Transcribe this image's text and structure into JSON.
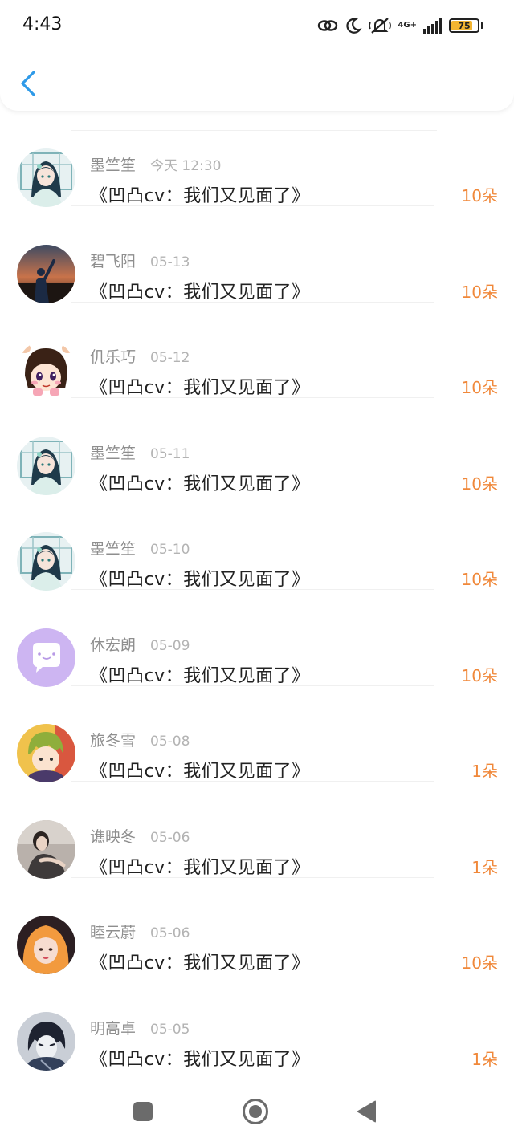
{
  "status_bar": {
    "time": "4:43",
    "network_label": "4G+",
    "battery_level": "75",
    "battery_fraction": 0.75,
    "icons": [
      "link-icon",
      "moon-icon",
      "mute-icon",
      "signal-icon",
      "battery-icon"
    ]
  },
  "header": {
    "back_icon": "chevron-left-icon",
    "accent_color": "#2f9ae8"
  },
  "colors": {
    "gift_count": "#f0883a",
    "sender_name": "#8e8e8e",
    "sender_time": "#b3b3b3",
    "message": "#222222"
  },
  "items": [
    {
      "name": "墨竺笙",
      "time": "今天 12:30",
      "message": "《凹凸cv：我们又见面了》",
      "gift": "10朵",
      "avatar": "anime-girl-avatar"
    },
    {
      "name": "碧飞阳",
      "time": "05-13",
      "message": "《凹凸cv：我们又见面了》",
      "gift": "10朵",
      "avatar": "sunset-person-avatar"
    },
    {
      "name": "仉乐巧",
      "time": "05-12",
      "message": "《凹凸cv：我们又见面了》",
      "gift": "10朵",
      "avatar": "cartoon-girl-avatar"
    },
    {
      "name": "墨竺笙",
      "time": "05-11",
      "message": "《凹凸cv：我们又见面了》",
      "gift": "10朵",
      "avatar": "anime-girl-avatar"
    },
    {
      "name": "墨竺笙",
      "time": "05-10",
      "message": "《凹凸cv：我们又见面了》",
      "gift": "10朵",
      "avatar": "anime-girl-avatar"
    },
    {
      "name": "休宏朗",
      "time": "05-09",
      "message": "《凹凸cv：我们又见面了》",
      "gift": "10朵",
      "avatar": "default-purple-avatar"
    },
    {
      "name": "旅冬雪",
      "time": "05-08",
      "message": "《凹凸cv：我们又见面了》",
      "gift": "1朵",
      "avatar": "anime-boy-avatar"
    },
    {
      "name": "谯映冬",
      "time": "05-06",
      "message": "《凹凸cv：我们又见面了》",
      "gift": "1朵",
      "avatar": "woman-photo-avatar"
    },
    {
      "name": "睦云蔚",
      "time": "05-06",
      "message": "《凹凸cv：我们又见面了》",
      "gift": "10朵",
      "avatar": "orange-hair-avatar"
    },
    {
      "name": "明高卓",
      "time": "05-05",
      "message": "《凹凸cv：我们又见面了》",
      "gift": "1朵",
      "avatar": "dark-anime-avatar"
    }
  ],
  "nav_bar": {
    "icons": [
      "recents-square-icon",
      "home-circle-icon",
      "back-triangle-icon"
    ]
  }
}
